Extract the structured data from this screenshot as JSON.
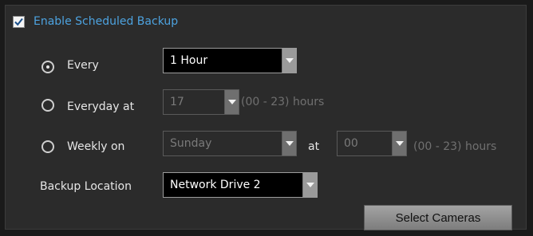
{
  "enable": {
    "label": "Enable Scheduled Backup",
    "checked": true
  },
  "every": {
    "label": "Every",
    "selected": true,
    "value": "1 Hour"
  },
  "everyday": {
    "label": "Everyday at",
    "selected": false,
    "value": "17",
    "hint": "(00 - 23) hours"
  },
  "weekly": {
    "label": "Weekly on",
    "selected": false,
    "day": "Sunday",
    "at_label": "at",
    "hour": "00",
    "hint": "(00 - 23) hours"
  },
  "backup_location": {
    "label": "Backup Location",
    "value": "Network Drive 2"
  },
  "select_cameras_button": "Select Cameras",
  "colors": {
    "accent": "#4da3e0",
    "background": "#2b2b2b"
  }
}
